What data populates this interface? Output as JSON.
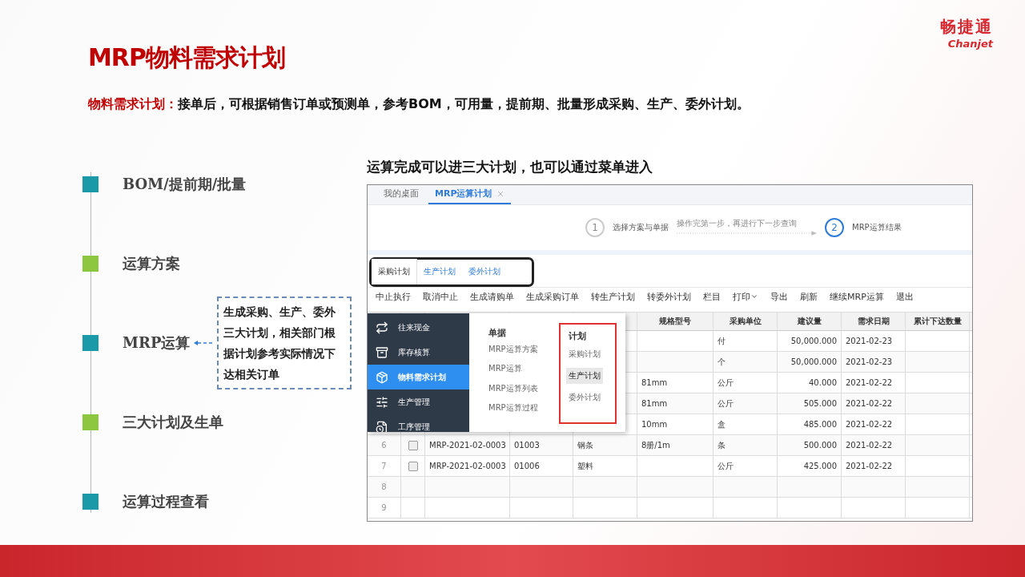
{
  "slide": {
    "title": "MRP物料需求计划",
    "logo": {
      "name": "畅捷通",
      "latin": "Chanjet"
    },
    "intro": {
      "lead": "物料需求计划：",
      "text": "接单后，可根据销售订单或预测单，参考BOM，可用量，提前期、批量形成采购、生产、委外计划。"
    }
  },
  "outline": [
    {
      "label": "BOM/提前期/批量",
      "color": "#1a9aa8"
    },
    {
      "label": "运算方案",
      "color": "#8dc63f"
    },
    {
      "label": "MRP运算",
      "color": "#1a9aa8",
      "note": "生成采购、生产、委外三大计划，相关部门根据计划参考实际情况下达相关订单"
    },
    {
      "label": "三大计划及生单",
      "color": "#8dc63f"
    },
    {
      "label": "运算过程查看",
      "color": "#1a9aa8"
    }
  ],
  "caption": "运算完成可以进三大计划，也可以通过菜单进入",
  "app": {
    "tabs": [
      {
        "label": "我的桌面",
        "selected": false,
        "closable": false
      },
      {
        "label": "MRP运算计划",
        "selected": true,
        "closable": true
      }
    ],
    "steps": [
      {
        "number": "1",
        "label": "选择方案与单据",
        "selected": false
      },
      {
        "number": "2",
        "label": "MRP运算结果",
        "selected": true
      }
    ],
    "step_hint": "操作完第一步，再进行下一步查询",
    "plan_tabs": [
      {
        "label": "采购计划",
        "selected": true
      },
      {
        "label": "生产计划",
        "selected": false
      },
      {
        "label": "委外计划",
        "selected": false
      }
    ],
    "toolbar": [
      {
        "label": "中止执行",
        "kind": "button"
      },
      {
        "label": "取消中止",
        "kind": "button"
      },
      {
        "label": "生成请购单",
        "kind": "button"
      },
      {
        "label": "生成采购订单",
        "kind": "button"
      },
      {
        "label": "转生产计划",
        "kind": "button"
      },
      {
        "label": "转委外计划",
        "kind": "button"
      },
      {
        "label": "栏目",
        "kind": "button"
      },
      {
        "label": "打印",
        "kind": "dropdown"
      },
      {
        "label": "导出",
        "kind": "button"
      },
      {
        "label": "刷新",
        "kind": "button"
      },
      {
        "label": "继续MRP运算",
        "kind": "button"
      },
      {
        "label": "退出",
        "kind": "button"
      }
    ],
    "table": {
      "columns": [
        "规格型号",
        "采购单位",
        "建议量",
        "需求日期",
        "累计下达数量"
      ],
      "rows": [
        {
          "unit": "付",
          "qty": "50,000.000",
          "date": "2021-02-23"
        },
        {
          "unit": "个",
          "qty": "50,000.000",
          "date": "2021-02-23"
        },
        {
          "spec": "81mm",
          "unit": "公斤",
          "qty": "40.000",
          "date": "2021-02-22"
        },
        {
          "spec": "81mm",
          "unit": "公斤",
          "qty": "505.000",
          "date": "2021-02-22"
        },
        {
          "spec": "10mm",
          "unit": "盒",
          "qty": "485.000",
          "date": "2021-02-22"
        },
        {
          "no": "6",
          "checked": false,
          "order": "MRP-2021-02-0003",
          "code": "01003",
          "name": "钢条",
          "spec": "8册/1m",
          "unit": "条",
          "qty": "500.000",
          "date": "2021-02-22"
        },
        {
          "no": "7",
          "checked": false,
          "order": "MRP-2021-02-0003",
          "code": "01006",
          "name": "塑料",
          "unit": "公斤",
          "qty": "425.000",
          "date": "2021-02-22"
        },
        {
          "no": "8"
        },
        {
          "no": "9"
        }
      ]
    },
    "menu": {
      "modules": [
        {
          "label": "往来现金",
          "selected": false
        },
        {
          "label": "库存核算",
          "selected": false
        },
        {
          "label": "物料需求计划",
          "selected": true
        },
        {
          "label": "生产管理",
          "selected": false
        },
        {
          "label": "工序管理",
          "selected": false
        }
      ],
      "sections": [
        {
          "title": "单据",
          "highlighted": false,
          "items": [
            {
              "label": "MRP运算方案",
              "selected": false
            },
            {
              "label": "MRP运算",
              "selected": false
            },
            {
              "label": "MRP运算列表",
              "selected": false
            },
            {
              "label": "MRP运算过程",
              "selected": false
            }
          ]
        },
        {
          "title": "计划",
          "highlighted": true,
          "items": [
            {
              "label": "采购计划",
              "selected": false
            },
            {
              "label": "生产计划",
              "selected": true
            },
            {
              "label": "委外计划",
              "selected": false
            }
          ]
        }
      ]
    }
  }
}
